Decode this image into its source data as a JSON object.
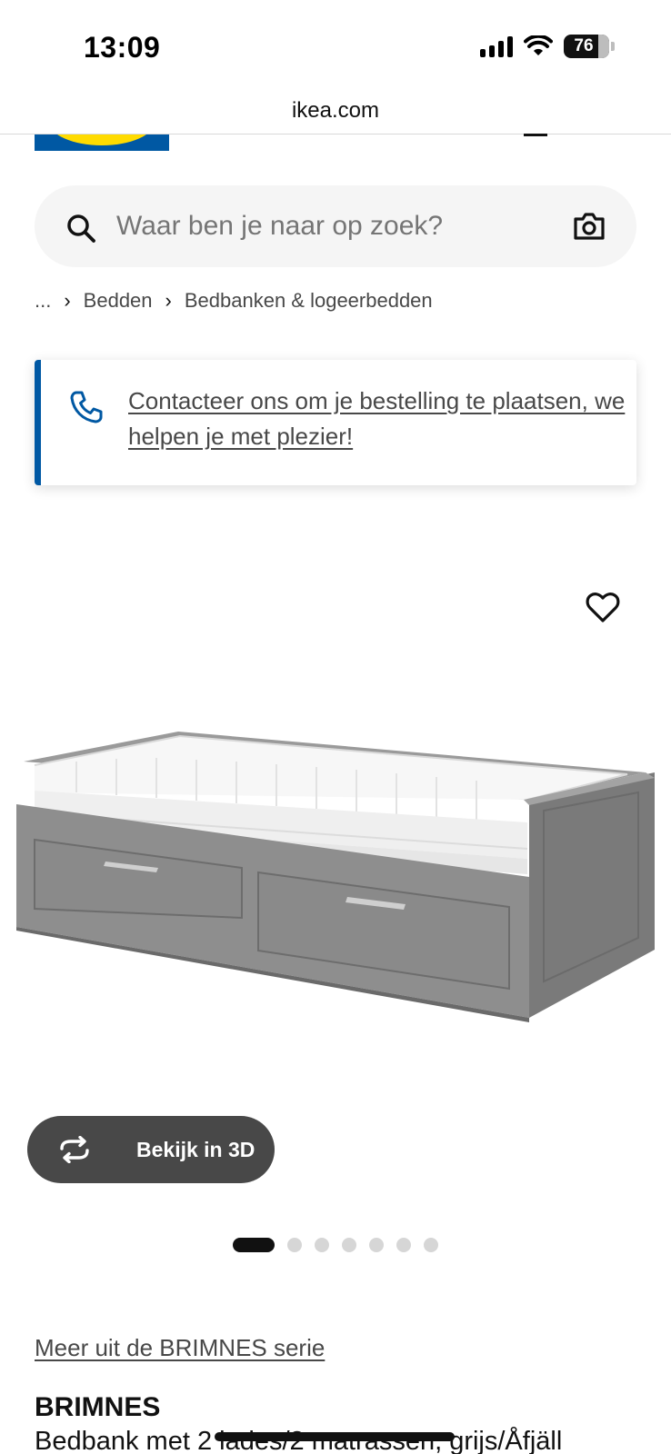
{
  "status": {
    "time": "13:09",
    "battery": "76"
  },
  "browser": {
    "url": "ikea.com"
  },
  "search": {
    "placeholder": "Waar ben je naar op zoek?"
  },
  "breadcrumb": {
    "ellipsis": "...",
    "items": [
      "Bedden",
      "Bedbanken & logeerbedden"
    ]
  },
  "contact": {
    "text": "Contacteer ons om je bestelling te plaatsen, we helpen je met plezier!"
  },
  "media": {
    "view_3d_label": "Bekijk in 3D",
    "carousel_total": 7,
    "carousel_active": 1
  },
  "product": {
    "series_link": "Meer uit de BRIMNES serie",
    "name": "BRIMNES",
    "description": "Bedbank met 2 lades/2 matrassen, grijs/Åfjäll"
  },
  "colors": {
    "ikea_blue": "#0058a3",
    "ikea_yellow": "#ffdb00",
    "frame_grey": "#8c8c8c"
  },
  "icons": [
    "search-icon",
    "camera-icon",
    "phone-icon",
    "heart-icon",
    "rotate-3d-icon",
    "chevron-right-icon"
  ]
}
